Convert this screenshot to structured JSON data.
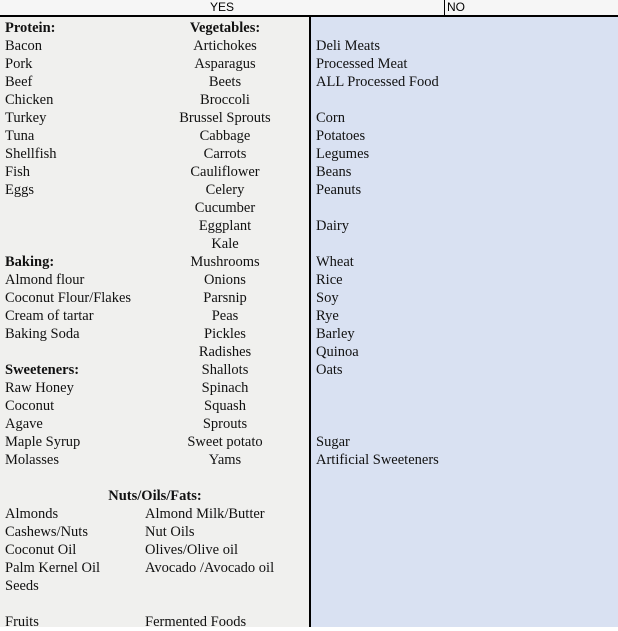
{
  "header": {
    "yes_label": "YES",
    "no_label": "NO"
  },
  "colors": {
    "yes_background": "#f0f0ee",
    "no_background": "#d9e1f2",
    "header_background": "#f6f6f6",
    "divider": "#000000",
    "text": "#111111"
  },
  "rows": [
    {
      "a": "Protein:",
      "a_bold": true,
      "b": "Vegetables:",
      "b_bold": true,
      "c": ""
    },
    {
      "a": "Bacon",
      "b": "Artichokes",
      "c": "Deli Meats"
    },
    {
      "a": "Pork",
      "b": "Asparagus",
      "c": "Processed Meat"
    },
    {
      "a": "Beef",
      "b": "Beets",
      "c": "ALL Processed Food"
    },
    {
      "a": "Chicken",
      "b": "Broccoli",
      "c": ""
    },
    {
      "a": "Turkey",
      "b": "Brussel Sprouts",
      "c": "Corn"
    },
    {
      "a": "Tuna",
      "b": "Cabbage",
      "c": "Potatoes"
    },
    {
      "a": "Shellfish",
      "b": "Carrots",
      "c": "Legumes"
    },
    {
      "a": "Fish",
      "b": "Cauliflower",
      "c": "Beans"
    },
    {
      "a": "Eggs",
      "b": "Celery",
      "c": "Peanuts"
    },
    {
      "a": "",
      "b": "Cucumber",
      "c": ""
    },
    {
      "a": "",
      "b": "Eggplant",
      "c": "Dairy"
    },
    {
      "a": "",
      "b": "Kale",
      "c": ""
    },
    {
      "a": "Baking:",
      "a_bold": true,
      "b": "Mushrooms",
      "c": "Wheat"
    },
    {
      "a": "Almond flour",
      "b": "Onions",
      "c": "Rice"
    },
    {
      "a": "Coconut Flour/Flakes",
      "b": "Parsnip",
      "c": "Soy"
    },
    {
      "a": "Cream of tartar",
      "b": "Peas",
      "c": "Rye"
    },
    {
      "a": "Baking Soda",
      "b": "Pickles",
      "c": "Barley"
    },
    {
      "a": "",
      "b": "Radishes",
      "c": "Quinoa"
    },
    {
      "a": "Sweeteners:",
      "a_bold": true,
      "b": "Shallots",
      "c": "Oats"
    },
    {
      "a": "Raw Honey",
      "b": "Spinach",
      "c": ""
    },
    {
      "a": "Coconut",
      "b": "Squash",
      "c": ""
    },
    {
      "a": "Agave",
      "b": "Sprouts",
      "c": ""
    },
    {
      "a": "Maple Syrup",
      "b": "Sweet potato",
      "c": "Sugar"
    },
    {
      "a": "Molasses",
      "b": "Yams",
      "c": "Artificial Sweeteners"
    }
  ],
  "bottom_section": {
    "title": "Nuts/Oils/Fats:",
    "rows": [
      {
        "a": "Almonds",
        "b": "Almond Milk/Butter"
      },
      {
        "a": "Cashews/Nuts",
        "b": " Nut Oils"
      },
      {
        "a": "Coconut Oil",
        "b": "Olives/Olive oil"
      },
      {
        "a": "Palm Kernel Oil",
        "b": "Avocado /Avocado oil"
      },
      {
        "a": "Seeds",
        "b": ""
      },
      {
        "a": "",
        "b": ""
      },
      {
        "a": "Fruits",
        "b": "Fermented Foods"
      }
    ]
  }
}
